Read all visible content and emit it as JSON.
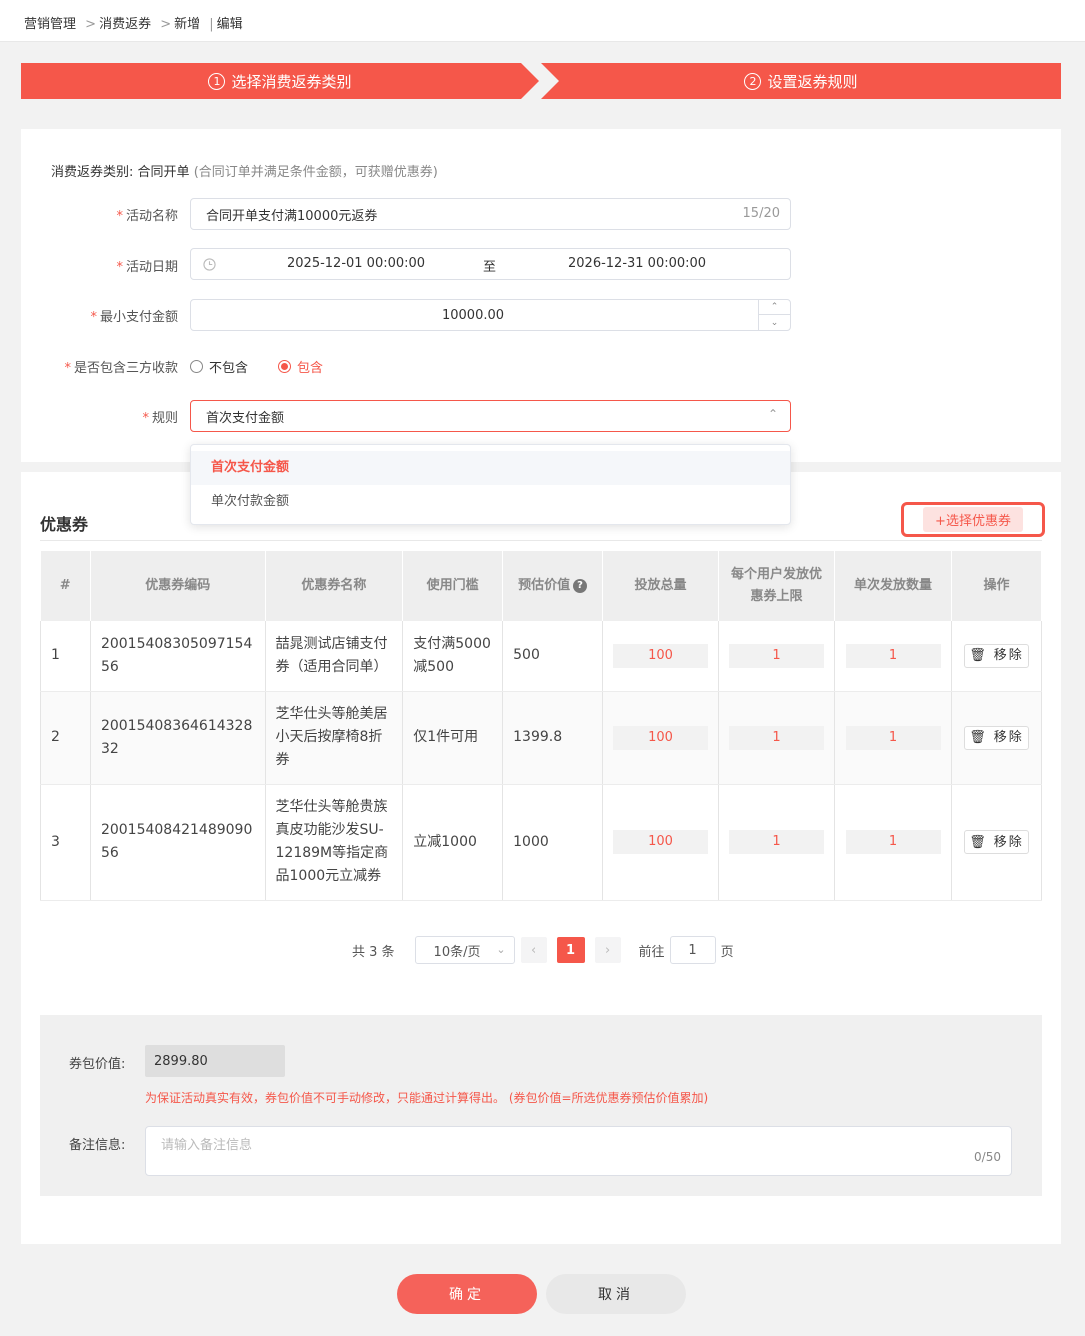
{
  "breadcrumb": {
    "item1": "营销管理",
    "item2": "消费返券",
    "item3": "新增",
    "item4": "编辑"
  },
  "steps": [
    {
      "num": "1",
      "label": "选择消费返券类别"
    },
    {
      "num": "2",
      "label": "设置返券规则"
    }
  ],
  "form": {
    "category_label": "消费返券类别:",
    "category_value": "合同开单",
    "category_hint": "(合同订单并满足条件金额，可获赠优惠券)",
    "name_label": "活动名称",
    "name_value": "合同开单支付满10000元返券",
    "name_counter": "15/20",
    "date_label": "活动日期",
    "date_start": "2025-12-01 00:00:00",
    "date_sep": "至",
    "date_end": "2026-12-31 00:00:00",
    "min_label": "最小支付金额",
    "min_value": "10000.00",
    "third_label": "是否包含三方收款",
    "third_opt1": "不包含",
    "third_opt2": "包含",
    "rule_label": "规则",
    "rule_value": "首次支付金额",
    "rule_options": [
      "首次支付金额",
      "单次付款金额"
    ],
    "required_mark": "*"
  },
  "coupon_section": {
    "title": "优惠券",
    "select_button": "+选择优惠券"
  },
  "table": {
    "headers": [
      "#",
      "优惠券编码",
      "优惠券名称",
      "使用门槛",
      "预估价值",
      "投放总量",
      "每个用户发放优惠券上限",
      "单次发放数量",
      "操作"
    ],
    "header_help": "?",
    "remove_label": "移除",
    "rows": [
      {
        "idx": "1",
        "code": "2001540830509715456",
        "name": "喆晁测试店铺支付券（适用合同单）",
        "threshold": "支付满5000减500",
        "value": "500",
        "total": "100",
        "limit": "1",
        "per": "1"
      },
      {
        "idx": "2",
        "code": "2001540836461432832",
        "name": "芝华仕头等舱美居小天后按摩椅8折券",
        "threshold": "仅1件可用",
        "value": "1399.8",
        "total": "100",
        "limit": "1",
        "per": "1"
      },
      {
        "idx": "3",
        "code": "2001540842148909056",
        "name": "芝华仕头等舱贵族真皮功能沙发SU-12189M等指定商品1000元立减券",
        "threshold": "立减1000",
        "value": "1000",
        "total": "100",
        "limit": "1",
        "per": "1"
      }
    ]
  },
  "pagination": {
    "total_text": "共 3 条",
    "page_size": "10条/页",
    "current_page": "1",
    "goto_prefix": "前往",
    "goto_value": "1",
    "goto_suffix": "页"
  },
  "summary": {
    "value_label": "券包价值:",
    "value": "2899.80",
    "warning": "为保证活动真实有效，券包价值不可手动修改，只能通过计算得出。 (券包价值=所选优惠券预估价值累加)",
    "remark_label": "备注信息:",
    "remark_placeholder": "请输入备注信息",
    "remark_counter": "0/50"
  },
  "actions": {
    "confirm": "确定",
    "cancel": "取消"
  },
  "colors": {
    "accent": "#f5574a"
  }
}
